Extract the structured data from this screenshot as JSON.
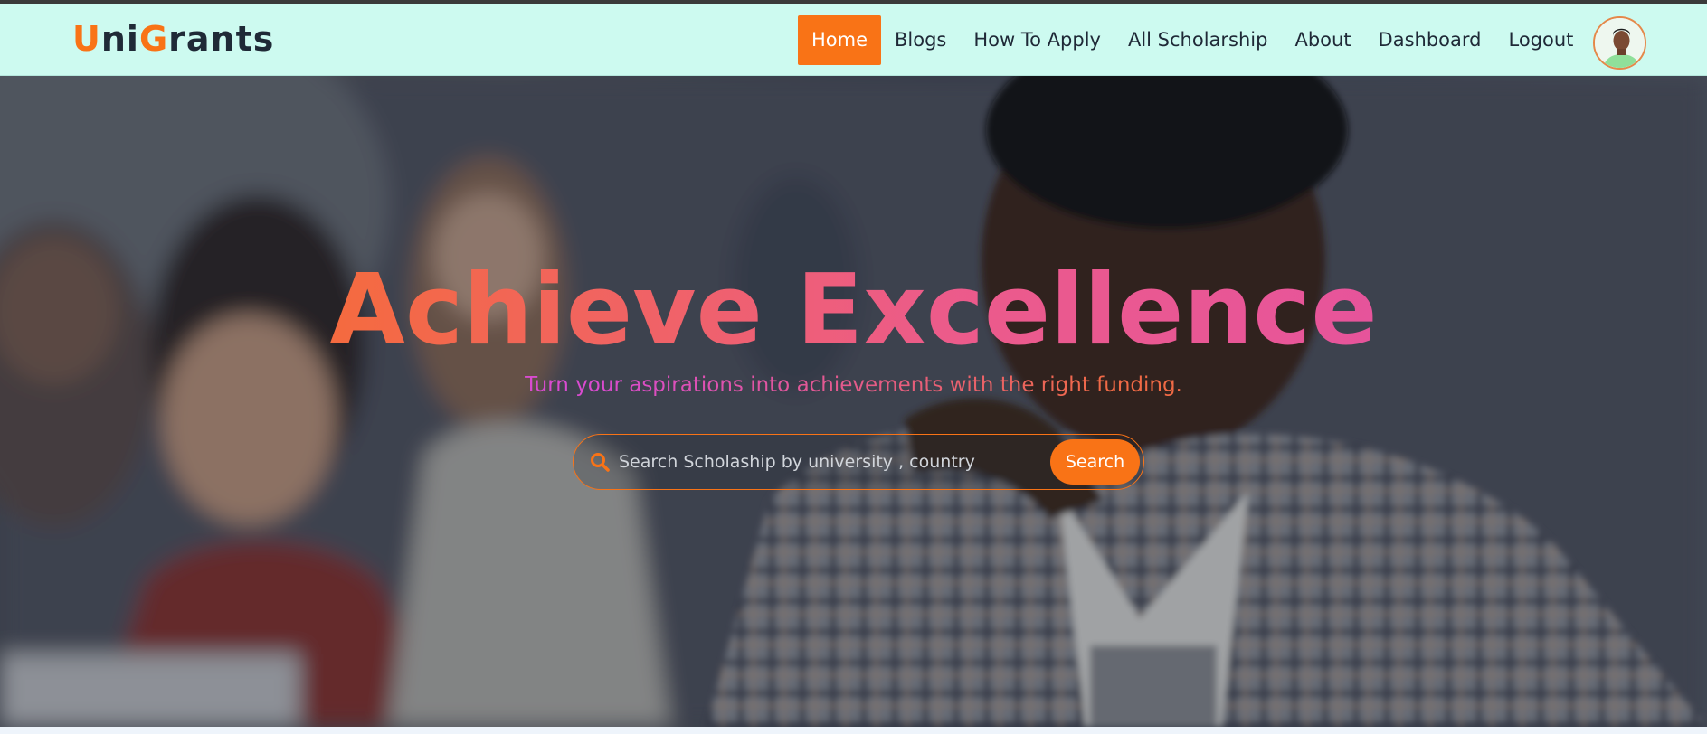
{
  "logo": {
    "part1": "U",
    "part2": "ni",
    "part3": "G",
    "part4": "rants"
  },
  "nav": {
    "items": [
      {
        "label": "Home",
        "active": true
      },
      {
        "label": "Blogs",
        "active": false
      },
      {
        "label": "How To Apply",
        "active": false
      },
      {
        "label": "All Scholarship",
        "active": false
      },
      {
        "label": "About",
        "active": false
      },
      {
        "label": "Dashboard",
        "active": false
      },
      {
        "label": "Logout",
        "active": false
      }
    ]
  },
  "hero": {
    "title": "Achieve Excellence",
    "subtitle": "Turn your aspirations into achievements with the right funding."
  },
  "search": {
    "placeholder": "Search Scholaship by university , country ...",
    "button_label": "Search",
    "icon": "search-icon"
  },
  "colors": {
    "accent": "#f97316",
    "navbar_bg": "#cdfaf0",
    "title_gradient_end": "#e24fa8"
  }
}
